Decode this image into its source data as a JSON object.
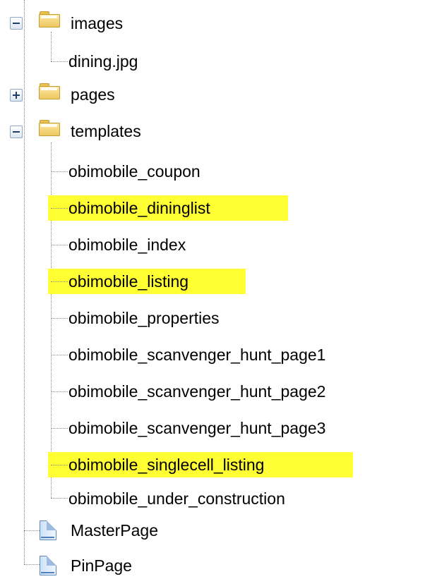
{
  "tree": {
    "nodes": [
      {
        "label": "images",
        "type": "folder",
        "expanded": true
      },
      {
        "label": "dining.jpg",
        "type": "file"
      },
      {
        "label": "pages",
        "type": "folder",
        "expanded": false
      },
      {
        "label": "templates",
        "type": "folder",
        "expanded": true
      },
      {
        "label": "obimobile_coupon",
        "type": "file",
        "highlighted": false
      },
      {
        "label": "obimobile_dininglist",
        "type": "file",
        "highlighted": true
      },
      {
        "label": "obimobile_index",
        "type": "file",
        "highlighted": false
      },
      {
        "label": "obimobile_listing",
        "type": "file",
        "highlighted": true
      },
      {
        "label": "obimobile_properties",
        "type": "file",
        "highlighted": false
      },
      {
        "label": "obimobile_scanvenger_hunt_page1",
        "type": "file",
        "highlighted": false
      },
      {
        "label": "obimobile_scanvenger_hunt_page2",
        "type": "file",
        "highlighted": false
      },
      {
        "label": "obimobile_scanvenger_hunt_page3",
        "type": "file",
        "highlighted": false
      },
      {
        "label": "obimobile_singlecell_listing",
        "type": "file",
        "highlighted": true
      },
      {
        "label": "obimobile_under_construction",
        "type": "file",
        "highlighted": false
      },
      {
        "label": "MasterPage",
        "type": "page"
      },
      {
        "label": "PinPage",
        "type": "page"
      }
    ]
  },
  "colors": {
    "highlight": "#ffff33",
    "connector": "#8a8a8a",
    "folder": "#efc860",
    "page": "#5d86b9"
  },
  "icons": {
    "folder": "folder-icon",
    "page": "page-icon",
    "collapse": "collapse-icon",
    "expand": "expand-icon"
  }
}
